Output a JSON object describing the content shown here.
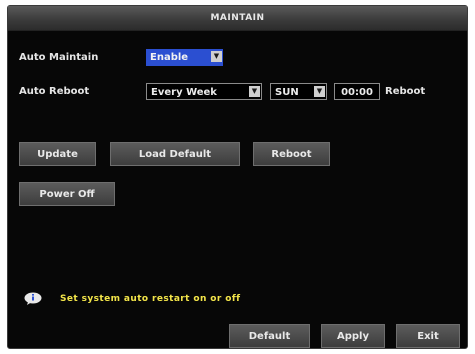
{
  "window": {
    "title": "MAINTAIN"
  },
  "auto_maintain": {
    "label": "Auto Maintain",
    "value": "Enable"
  },
  "auto_reboot": {
    "label": "Auto Reboot",
    "frequency": "Every Week",
    "day": "SUN",
    "time": "00:00",
    "suffix": "Reboot"
  },
  "actions": {
    "update": "Update",
    "load_default": "Load Default",
    "reboot": "Reboot",
    "power_off": "Power Off"
  },
  "hint": {
    "icon": "info-icon",
    "text": "Set system auto restart on or off"
  },
  "footer": {
    "default": "Default",
    "apply": "Apply",
    "exit": "Exit"
  },
  "colors": {
    "background": "#070707",
    "selected_field": "#2b4fd1",
    "hint_text": "#f3e54a"
  }
}
